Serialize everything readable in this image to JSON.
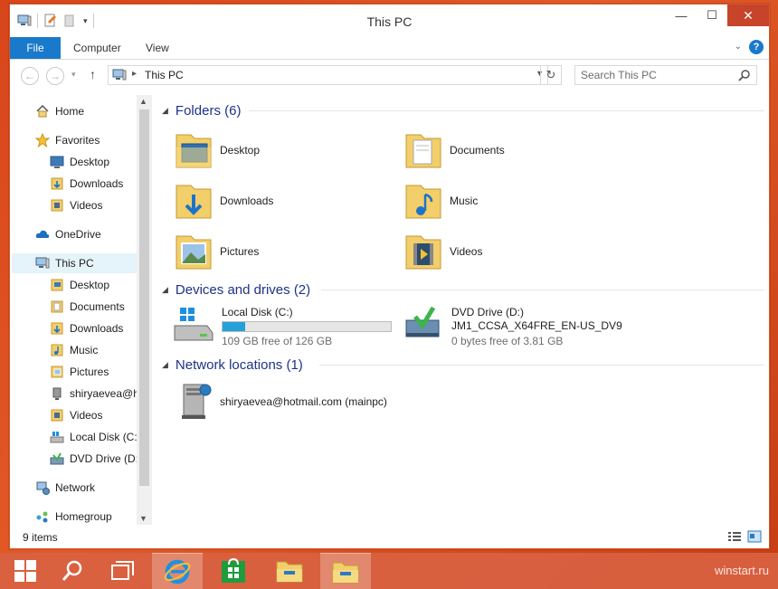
{
  "window": {
    "title": "This PC",
    "minimize_glyph": "—",
    "maximize_glyph": "☐",
    "close_glyph": "✕"
  },
  "ribbon": {
    "tabs": [
      "File",
      "Computer",
      "View"
    ],
    "help_glyph": "?",
    "expand_glyph": "⌄"
  },
  "address": {
    "path": "This PC",
    "back_glyph": "←",
    "forward_glyph": "→",
    "up_glyph": "↑",
    "recent_glyph": "▾",
    "refresh_glyph": "↻"
  },
  "search": {
    "placeholder": "Search This PC"
  },
  "nav": {
    "items": [
      {
        "label": "Home",
        "icon": "home-icon"
      },
      {
        "label": "Favorites",
        "icon": "star-icon"
      },
      {
        "label": "Desktop",
        "icon": "desktop-icon"
      },
      {
        "label": "Downloads",
        "icon": "downloads-folder-icon"
      },
      {
        "label": "Videos",
        "icon": "videos-folder-icon"
      },
      {
        "label": "OneDrive",
        "icon": "onedrive-cloud-icon"
      },
      {
        "label": "This PC",
        "icon": "computer-icon"
      },
      {
        "label": "Desktop",
        "icon": "folder-icon"
      },
      {
        "label": "Documents",
        "icon": "folder-icon"
      },
      {
        "label": "Downloads",
        "icon": "folder-icon"
      },
      {
        "label": "Music",
        "icon": "folder-icon"
      },
      {
        "label": "Pictures",
        "icon": "folder-icon"
      },
      {
        "label": "shiryaevea@hotmail.com",
        "icon": "network-share-icon"
      },
      {
        "label": "Videos",
        "icon": "folder-icon"
      },
      {
        "label": "Local Disk (C:)",
        "icon": "drive-icon"
      },
      {
        "label": "DVD Drive (D:)",
        "icon": "dvd-icon"
      },
      {
        "label": "Network",
        "icon": "network-icon"
      },
      {
        "label": "Homegroup",
        "icon": "homegroup-icon"
      }
    ]
  },
  "groups": {
    "folders": "Folders (6)",
    "devices": "Devices and drives (2)",
    "network": "Network locations (1)"
  },
  "folders": [
    "Desktop",
    "Documents",
    "Downloads",
    "Music",
    "Pictures",
    "Videos"
  ],
  "drives": [
    {
      "name": "Local Disk (C:)",
      "free": "109 GB free of 126 GB",
      "used_fraction": 0.135
    },
    {
      "name": "DVD Drive (D:)",
      "label": "JM1_CCSA_X64FRE_EN-US_DV9",
      "free": "0 bytes free of 3.81 GB"
    }
  ],
  "network_location": "shiryaevea@hotmail.com (mainpc)",
  "status": {
    "count": "9 items"
  },
  "watermark": "winstart.ru",
  "colors": {
    "accent": "#1979ca",
    "group_title": "#1e3287",
    "close": "#c7432a",
    "progress": "#26a0da"
  }
}
